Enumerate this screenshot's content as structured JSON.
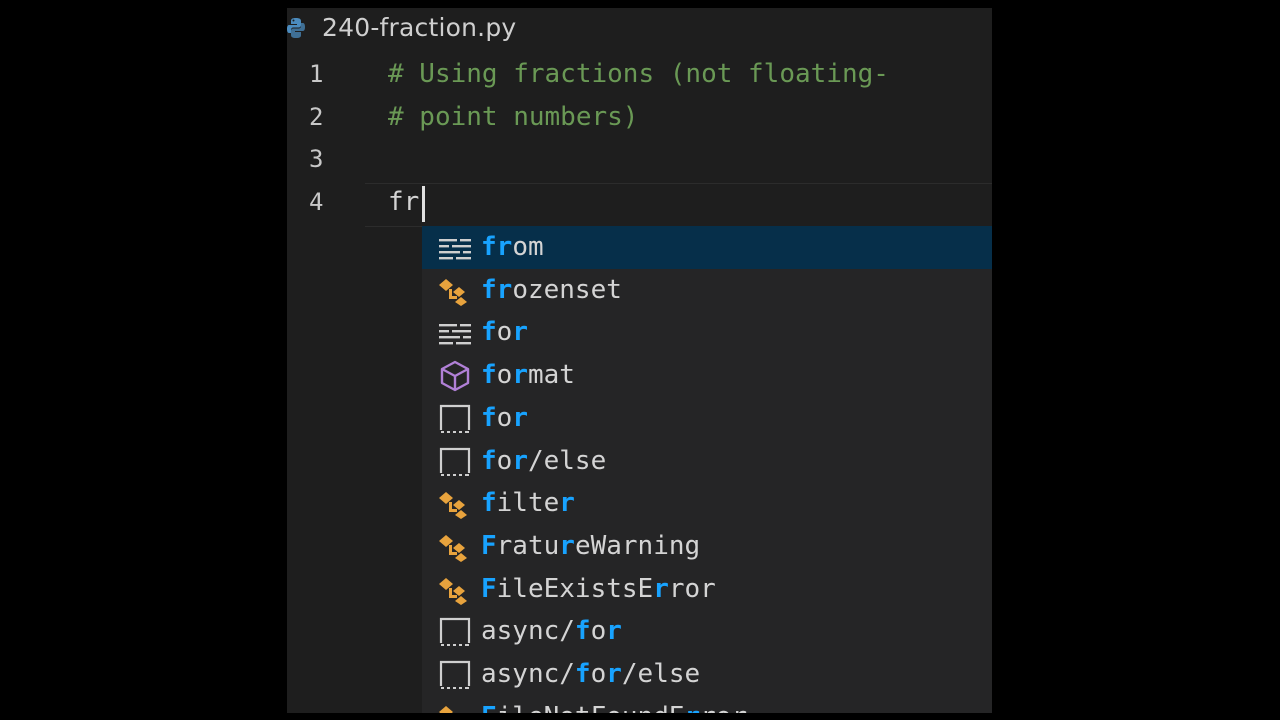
{
  "tab": {
    "filename": "240-fraction.py",
    "icon": "python-file-icon"
  },
  "lines": [
    {
      "number": "1",
      "text": "# Using fractions (not floating-",
      "kind": "comment"
    },
    {
      "number": "2",
      "text": "# point numbers)",
      "kind": "comment"
    },
    {
      "number": "3",
      "text": "",
      "kind": "blank"
    },
    {
      "number": "4",
      "text": "fr",
      "kind": "typed"
    }
  ],
  "suggestions": [
    {
      "icon": "keyword",
      "parts": [
        [
          "fr",
          true
        ],
        [
          "om",
          false
        ]
      ],
      "selected": true
    },
    {
      "icon": "class",
      "parts": [
        [
          "fr",
          true
        ],
        [
          "ozenset",
          false
        ]
      ]
    },
    {
      "icon": "keyword",
      "parts": [
        [
          "f",
          true
        ],
        [
          "o",
          false
        ],
        [
          "r",
          true
        ]
      ]
    },
    {
      "icon": "module",
      "parts": [
        [
          "f",
          true
        ],
        [
          "o",
          false
        ],
        [
          "r",
          true
        ],
        [
          "mat",
          false
        ]
      ]
    },
    {
      "icon": "snippet",
      "parts": [
        [
          "f",
          true
        ],
        [
          "o",
          false
        ],
        [
          "r",
          true
        ]
      ]
    },
    {
      "icon": "snippet",
      "parts": [
        [
          "f",
          true
        ],
        [
          "o",
          false
        ],
        [
          "r",
          true
        ],
        [
          "/else",
          false
        ]
      ]
    },
    {
      "icon": "class",
      "parts": [
        [
          "f",
          true
        ],
        [
          "ilte",
          false
        ],
        [
          "r",
          true
        ]
      ]
    },
    {
      "icon": "class",
      "parts": [
        [
          "F",
          true
        ],
        [
          "ratu",
          false
        ],
        [
          "r",
          true
        ],
        [
          "eWarning",
          false
        ]
      ]
    },
    {
      "icon": "class",
      "parts": [
        [
          "F",
          true
        ],
        [
          "ileExistsE",
          false
        ],
        [
          "r",
          true
        ],
        [
          "ror",
          false
        ]
      ]
    },
    {
      "icon": "snippet",
      "parts": [
        [
          "async/",
          false
        ],
        [
          "f",
          true
        ],
        [
          "o",
          false
        ],
        [
          "r",
          true
        ]
      ]
    },
    {
      "icon": "snippet",
      "parts": [
        [
          "async/",
          false
        ],
        [
          "f",
          true
        ],
        [
          "o",
          false
        ],
        [
          "r",
          true
        ],
        [
          "/else",
          false
        ]
      ]
    },
    {
      "icon": "class",
      "parts": [
        [
          "F",
          true
        ],
        [
          "ileNotFoundE",
          false
        ],
        [
          "r",
          true
        ],
        [
          "ror",
          false
        ]
      ]
    }
  ],
  "colors": {
    "comment": "#6a9955",
    "match": "#18a3ff",
    "selection": "#062f4a",
    "class_icon": "#e8a33d",
    "module_icon": "#b180d7"
  }
}
